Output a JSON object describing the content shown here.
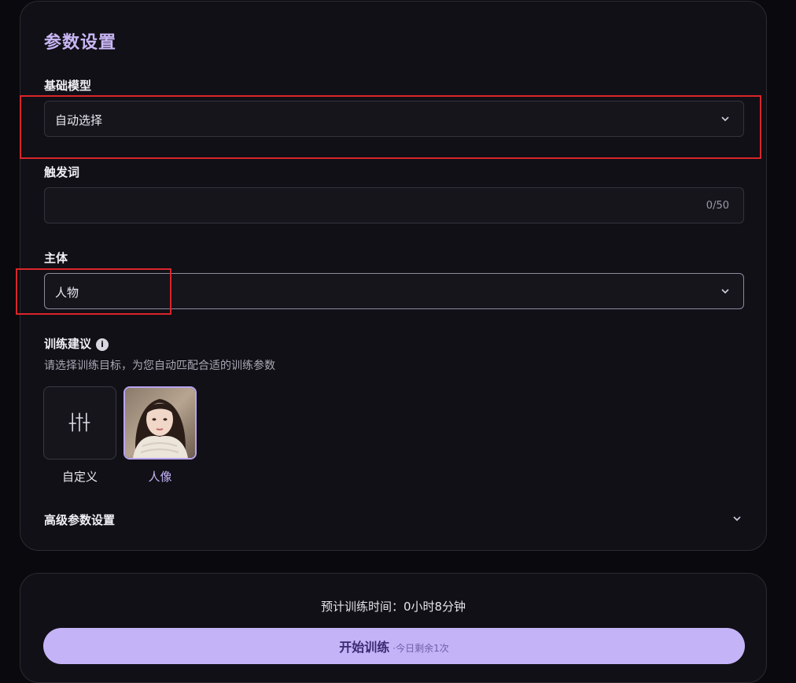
{
  "panel": {
    "title": "参数设置",
    "base_model": {
      "label": "基础模型",
      "value": "自动选择"
    },
    "trigger_word": {
      "label": "触发词",
      "value": "",
      "counter": "0/50"
    },
    "subject": {
      "label": "主体",
      "value": "人物"
    },
    "training_advice": {
      "label": "训练建议",
      "info_glyph": "i",
      "hint": "请选择训练目标，为您自动匹配合适的训练参数",
      "presets": [
        {
          "label": "自定义",
          "icon": "sliders-icon",
          "selected": false
        },
        {
          "label": "人像",
          "icon": "portrait-thumbnail",
          "selected": true
        }
      ]
    },
    "advanced": {
      "label": "高级参数设置"
    }
  },
  "footer": {
    "estimate": "预计训练时间：0小时8分钟",
    "start_label": "开始训练",
    "start_sub": "·今日剩余1次"
  },
  "colors": {
    "accent": "#c5b3f8",
    "title": "#c9b6f5",
    "highlight_box": "#d9262a",
    "background": "#0a090d",
    "panel": "#111016"
  }
}
